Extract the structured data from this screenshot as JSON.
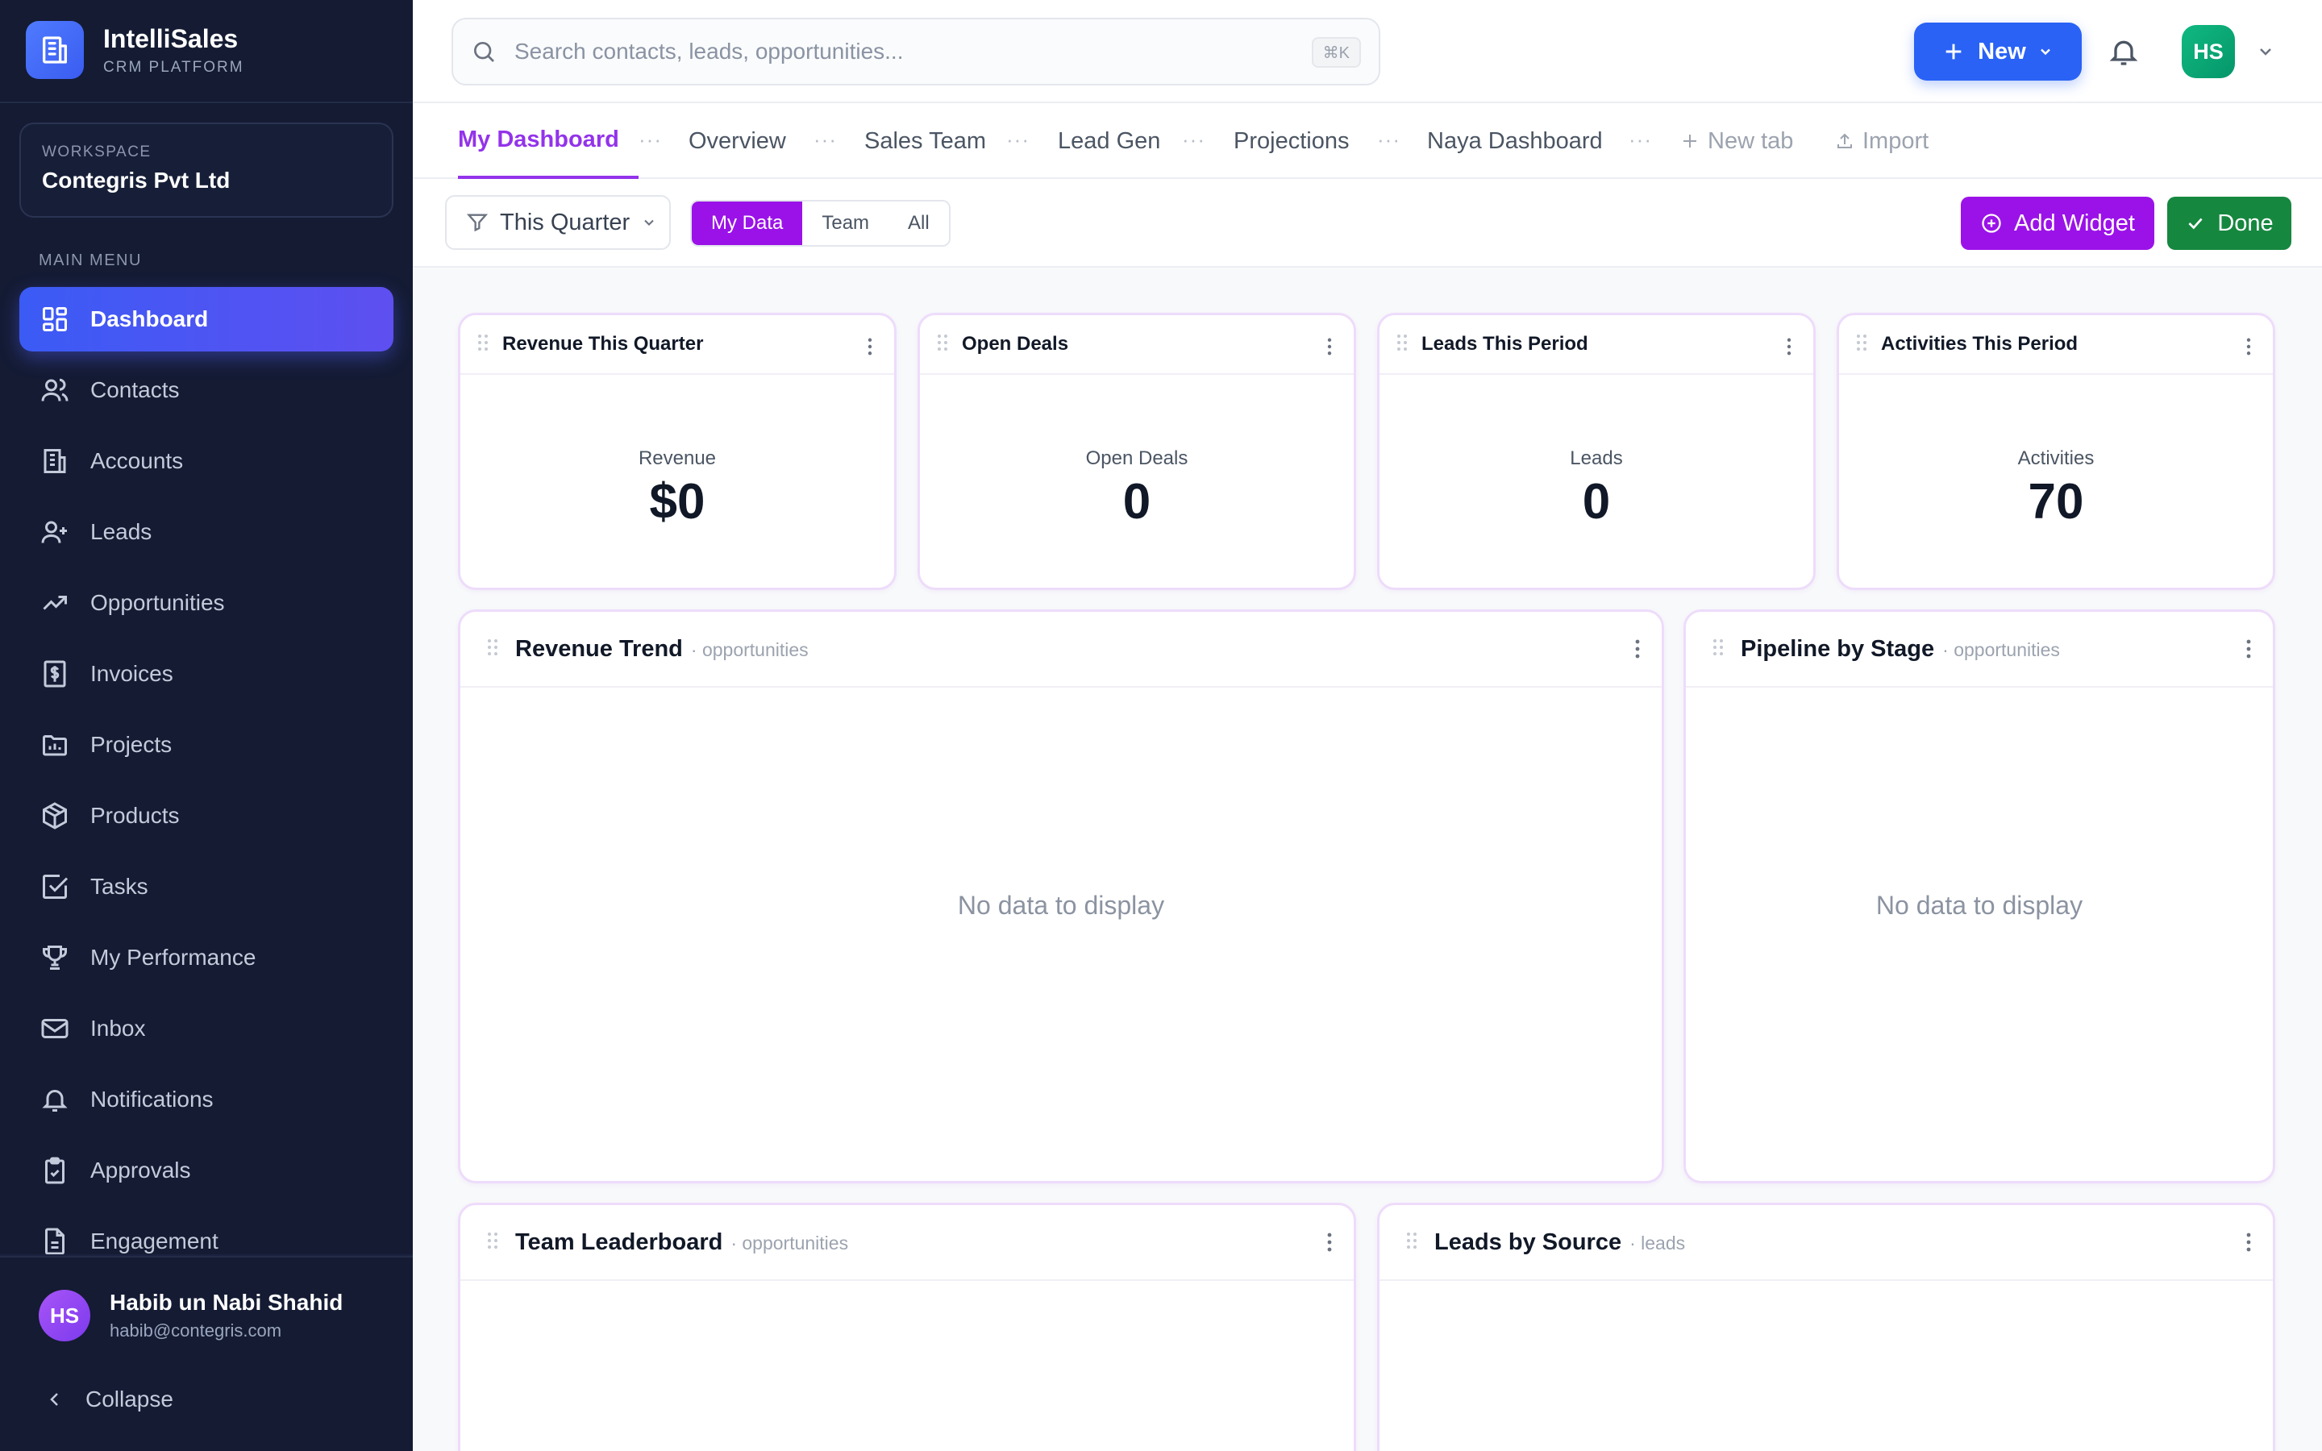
{
  "brand": {
    "name": "IntelliSales",
    "subtitle": "CRM PLATFORM"
  },
  "workspace": {
    "label": "WORKSPACE",
    "name": "Contegris Pvt Ltd"
  },
  "sidebar": {
    "menu_label": "MAIN MENU",
    "items": [
      {
        "label": "Dashboard",
        "icon": "dashboard-icon",
        "active": true
      },
      {
        "label": "Contacts",
        "icon": "users-icon"
      },
      {
        "label": "Accounts",
        "icon": "building-icon"
      },
      {
        "label": "Leads",
        "icon": "user-plus-icon"
      },
      {
        "label": "Opportunities",
        "icon": "trending-up-icon"
      },
      {
        "label": "Invoices",
        "icon": "dollar-receipt-icon"
      },
      {
        "label": "Projects",
        "icon": "folder-chart-icon"
      },
      {
        "label": "Products",
        "icon": "box-icon"
      },
      {
        "label": "Tasks",
        "icon": "checkbox-icon"
      },
      {
        "label": "My Performance",
        "icon": "trophy-icon"
      },
      {
        "label": "Inbox",
        "icon": "mail-icon"
      },
      {
        "label": "Notifications",
        "icon": "bell-icon"
      },
      {
        "label": "Approvals",
        "icon": "clipboard-check-icon"
      },
      {
        "label": "Engagement",
        "icon": "document-icon"
      }
    ],
    "user": {
      "initials": "HS",
      "name": "Habib un Nabi Shahid",
      "email": "habib@contegris.com"
    },
    "collapse_label": "Collapse"
  },
  "topbar": {
    "search_placeholder": "Search contacts, leads, opportunities...",
    "search_shortcut": "⌘K",
    "new_label": "New",
    "avatar_initials": "HS"
  },
  "tabs": {
    "items": [
      "My Dashboard",
      "Overview",
      "Sales Team",
      "Lead Gen",
      "Projections",
      "Naya Dashboard"
    ],
    "new_tab": "New tab",
    "import": "Import"
  },
  "toolbar": {
    "period": "This Quarter",
    "scope_options": [
      "My Data",
      "Team",
      "All"
    ],
    "scope_selected": "My Data",
    "add_widget": "Add Widget",
    "done": "Done"
  },
  "stats": [
    {
      "title": "Revenue This Quarter",
      "label": "Revenue",
      "value": "$0"
    },
    {
      "title": "Open Deals",
      "label": "Open Deals",
      "value": "0"
    },
    {
      "title": "Leads This Period",
      "label": "Leads",
      "value": "0"
    },
    {
      "title": "Activities This Period",
      "label": "Activities",
      "value": "70"
    }
  ],
  "widgets": [
    {
      "title": "Revenue Trend",
      "source": "· opportunities",
      "empty": "No data to display"
    },
    {
      "title": "Pipeline by Stage",
      "source": "· opportunities",
      "empty": "No data to display"
    },
    {
      "title": "Team Leaderboard",
      "source": "· opportunities"
    },
    {
      "title": "Leads by Source",
      "source": "· leads"
    }
  ],
  "colors": {
    "sidebar_bg": "#141b33",
    "primary_blue": "#2962f5",
    "accent_purple": "#9b12e8",
    "success_green": "#16873f"
  }
}
